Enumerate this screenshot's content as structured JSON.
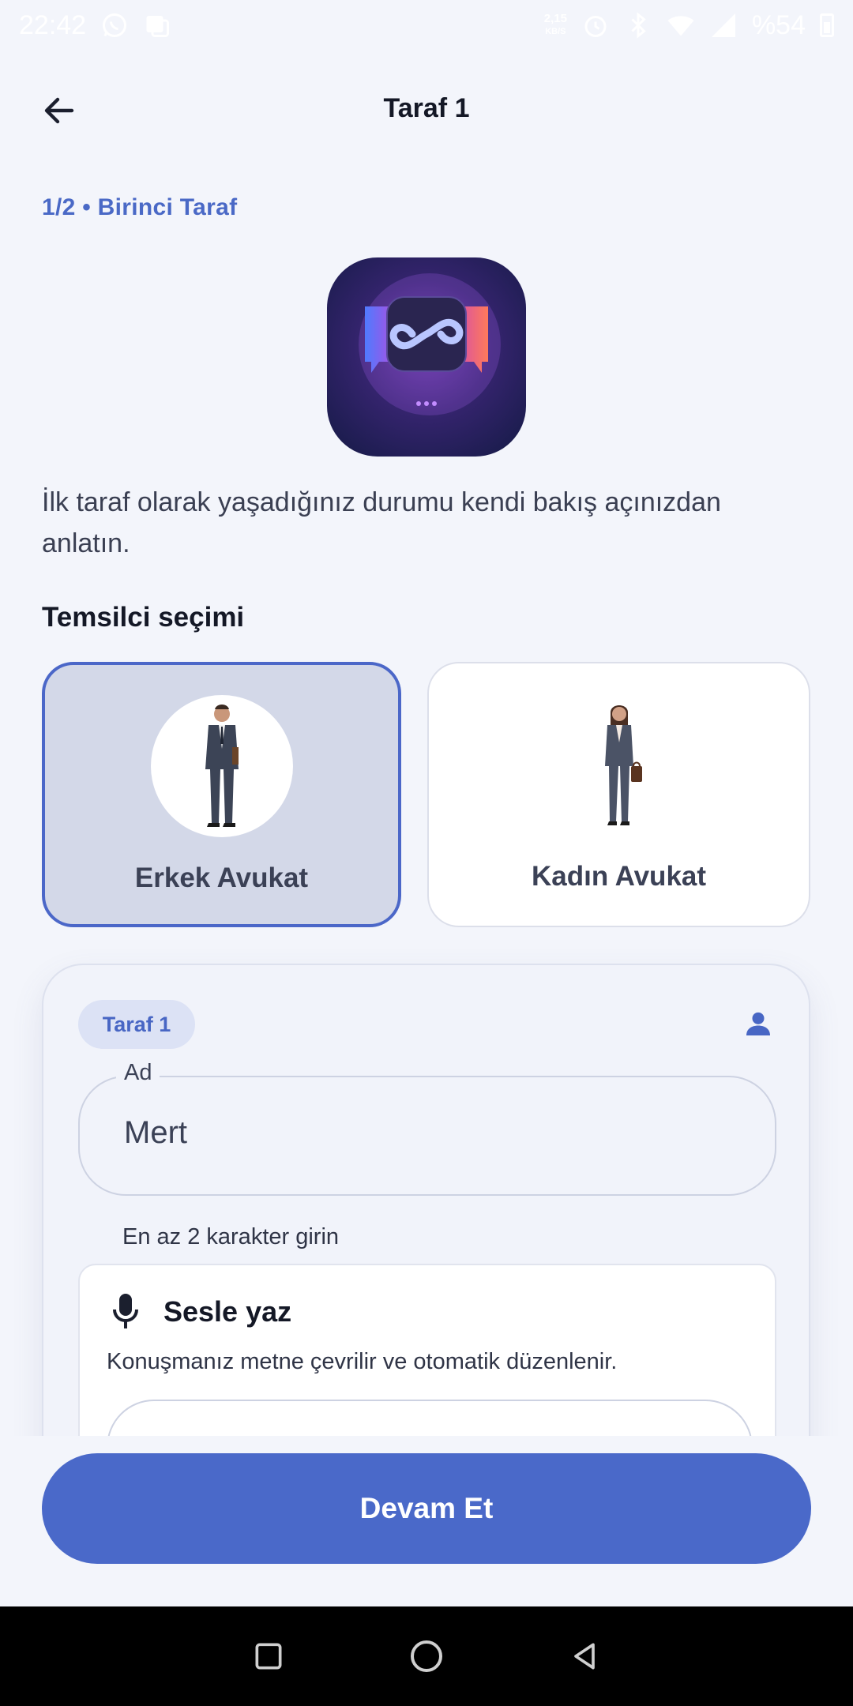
{
  "status_bar": {
    "time": "22:42",
    "net_speed_value": "2,15",
    "net_speed_unit": "KB/S",
    "battery": "%54"
  },
  "app_bar": {
    "title": "Taraf 1",
    "back_icon": "arrow-left-icon"
  },
  "step_label": "1/2 • Birinci Taraf",
  "intro_text": "İlk taraf olarak yaşadığınız durumu kendi bakış açınızdan anlatın.",
  "section_title": "Temsilci seçimi",
  "representatives": [
    {
      "label": "Erkek Avukat",
      "selected": true
    },
    {
      "label": "Kadın Avukat",
      "selected": false
    }
  ],
  "form": {
    "party_chip": "Taraf 1",
    "name_field": {
      "label": "Ad",
      "value": "Mert"
    },
    "helper_text": "En az 2 karakter girin",
    "voice": {
      "title": "Sesle yaz",
      "description": "Konuşmanız metne çevrilir ve otomatik düzenlenir."
    }
  },
  "continue_label": "Devam Et",
  "colors": {
    "accent": "#4a69c9",
    "background": "#f3f5fb",
    "selected_card": "#d3d8e8"
  }
}
